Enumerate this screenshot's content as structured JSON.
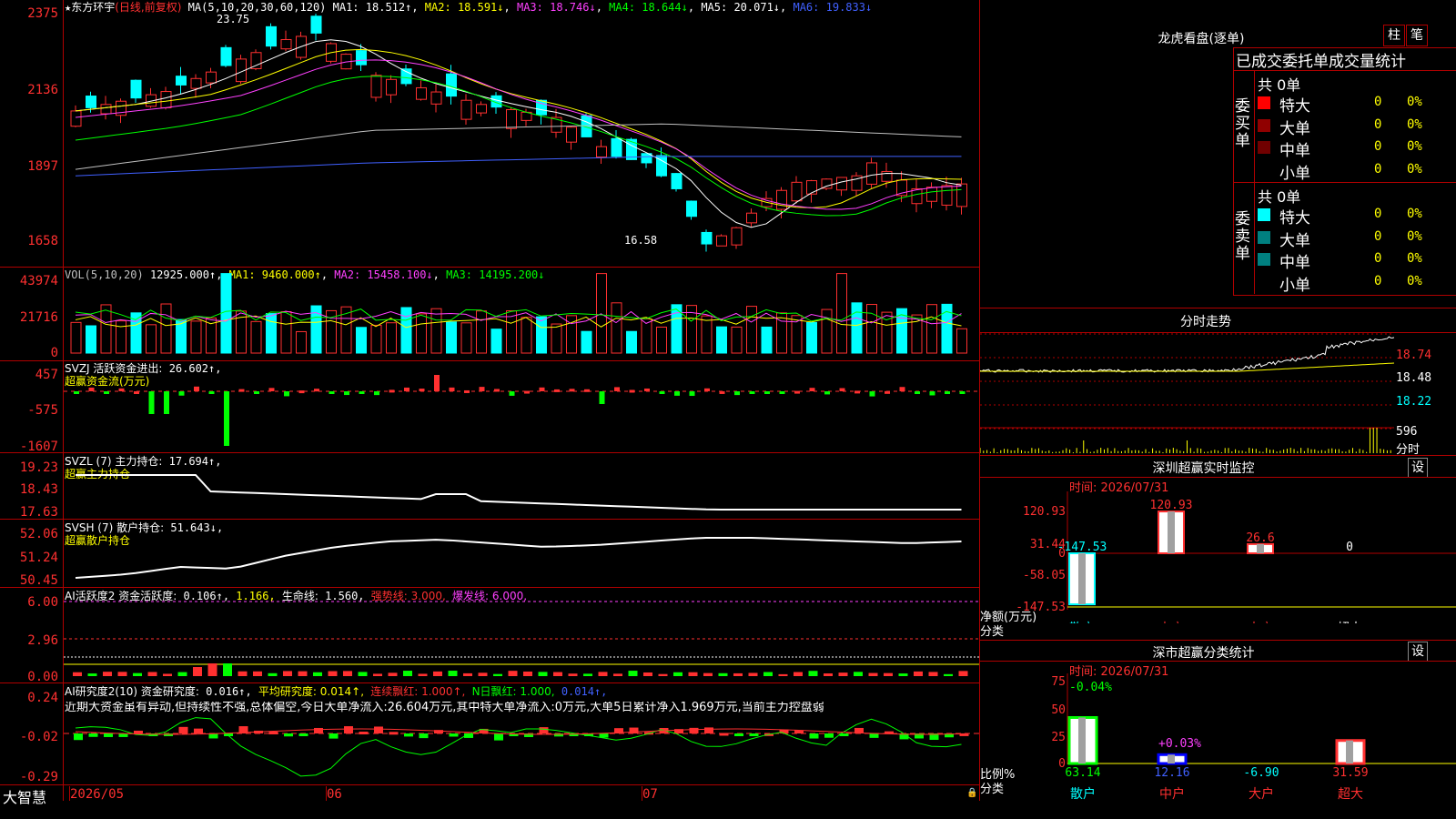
{
  "header": {
    "star": "★",
    "stock_name": "东方环宇",
    "mode": "(日线,前复权)",
    "ma_label": "MA(5,10,20,30,60,120)",
    "ma_values": [
      {
        "label": "MA1:",
        "value": "18.512↑",
        "color": "#ffffff"
      },
      {
        "label": "MA2:",
        "value": "18.591↓",
        "color": "#ffff00"
      },
      {
        "label": "MA3:",
        "value": "18.746↓",
        "color": "#ff40ff"
      },
      {
        "label": "MA4:",
        "value": "18.644↓",
        "color": "#00ff00"
      },
      {
        "label": "MA5:",
        "value": "20.071↓",
        "color": "#ffffff"
      },
      {
        "label": "MA6:",
        "value": "19.833↓",
        "color": "#4060ff"
      }
    ]
  },
  "main_chart": {
    "y_ticks": [
      "2375",
      "2136",
      "1897",
      "1658"
    ],
    "high_mark": "23.75",
    "low_mark": "16.58"
  },
  "vol_panel": {
    "y_ticks": [
      "43974",
      "21716",
      "0"
    ],
    "header": "VOL(5,10,20)",
    "value": "12925.000↑",
    "items": [
      {
        "label": "MA1:",
        "value": "9460.000↑",
        "color": "#ffff00"
      },
      {
        "label": "MA2:",
        "value": "15458.100↓",
        "color": "#ff40ff"
      },
      {
        "label": "MA3:",
        "value": "14195.200↓",
        "color": "#00ff00"
      }
    ]
  },
  "svzj_panel": {
    "y_ticks": [
      "457",
      "-575",
      "-1607"
    ],
    "header": "SVZJ  活跃资金进出:",
    "value": "26.602↑,",
    "subtitle": "超赢资金流(万元)"
  },
  "svzl_panel": {
    "y_ticks": [
      "19.23",
      "18.43",
      "17.63"
    ],
    "header": "SVZL (7) 主力持仓:",
    "value": "17.694↑,",
    "subtitle": "超赢主力持仓"
  },
  "svsh_panel": {
    "y_ticks": [
      "52.06",
      "51.24",
      "50.45"
    ],
    "header": "SVSH (7) 散户持仓:",
    "value": "51.643↓,",
    "subtitle": "超赢散户持仓"
  },
  "ai_active": {
    "y_ticks": [
      "6.00",
      "2.96",
      "0.00"
    ],
    "header": "AI活跃度2 资金活跃度:",
    "v1": "0.106↑,",
    "v2": "1.166,",
    "life_label": "生命线:",
    "life_value": "1.560,",
    "strong": "强势线: 3.000,",
    "burst": "爆发线: 6.000,"
  },
  "ai_research": {
    "y_ticks": [
      "0.24",
      "-0.02",
      "-0.29"
    ],
    "header": "AI研究度2(10) 资金研究度:",
    "v1": "0.016↑,",
    "avg": "平均研究度: 0.014↑,",
    "cont": "连续飘红: 1.000↑,",
    "nday": "N日飘红: 1.000,",
    "last": "0.014↑,",
    "comment": "近期大资金虽有异动,但持续性不强,总体偏空,今日大单净流入:26.604万元,其中特大单净流入:0万元,大单5日累计净入1.969万元,当前主力控盘弱"
  },
  "x_axis": {
    "labels": [
      "2026/05",
      "06",
      "07"
    ],
    "brand": "大智慧"
  },
  "dragon": {
    "title": "龙虎看盘(逐单)",
    "btn_bar": "柱",
    "btn_pen": "笔",
    "subtitle": "已成交委托单成交量统计",
    "buy_label": "委买单",
    "sell_label": "委卖单",
    "buy_total": "共 0单",
    "sell_total": "共 0单",
    "buy_rows": [
      {
        "name": "特大",
        "count": "0",
        "pct": "0%",
        "color": "#ff0000"
      },
      {
        "name": "大单",
        "count": "0",
        "pct": "0%",
        "color": "#900000"
      },
      {
        "name": "中单",
        "count": "0",
        "pct": "0%",
        "color": "#700000"
      },
      {
        "name": "小单",
        "count": "0",
        "pct": "0%",
        "color": "#000000"
      }
    ],
    "sell_rows": [
      {
        "name": "特大",
        "count": "0",
        "pct": "0%",
        "color": "#00ffff"
      },
      {
        "name": "大单",
        "count": "0",
        "pct": "0%",
        "color": "#008080"
      },
      {
        "name": "中单",
        "count": "0",
        "pct": "0%",
        "color": "#008080"
      },
      {
        "name": "小单",
        "count": "0",
        "pct": "0%",
        "color": "#000000"
      }
    ]
  },
  "intraday": {
    "title": "分时走势",
    "y_ticks": [
      "18.74",
      "18.48",
      "18.22"
    ],
    "vol_top": "596",
    "vol_label": "分时"
  },
  "sz_monitor": {
    "title": "深圳超赢实时监控",
    "settings": "设",
    "time": "时间: 2026/07/31",
    "y_ticks": [
      "120.93",
      "31.44",
      "0",
      "-58.05",
      "-147.53"
    ],
    "bar_labels": [
      "-147.53",
      "120.93",
      "26.6",
      "0"
    ],
    "axis_caption1": "净额(万元)",
    "axis_caption2": "分类",
    "categories": [
      "散户",
      "中户",
      "大户",
      "超大"
    ],
    "values": [
      -147.53,
      120.93,
      26.6,
      0
    ]
  },
  "sz_class": {
    "title": "深市超赢分类统计",
    "settings": "设",
    "time": "时间: 2026/07/31",
    "y_ticks": [
      "75",
      "50",
      "25",
      "0"
    ],
    "bar_labels": [
      "-0.04%",
      "+0.03%"
    ],
    "axis_caption1": "比例%",
    "axis_caption2": "分类",
    "values_text": [
      "63.14",
      "12.16",
      "-6.90",
      "31.59"
    ],
    "categories": [
      "散户",
      "中户",
      "大户",
      "超大"
    ],
    "values": [
      63.14,
      12.16,
      -6.9,
      31.59
    ]
  }
}
